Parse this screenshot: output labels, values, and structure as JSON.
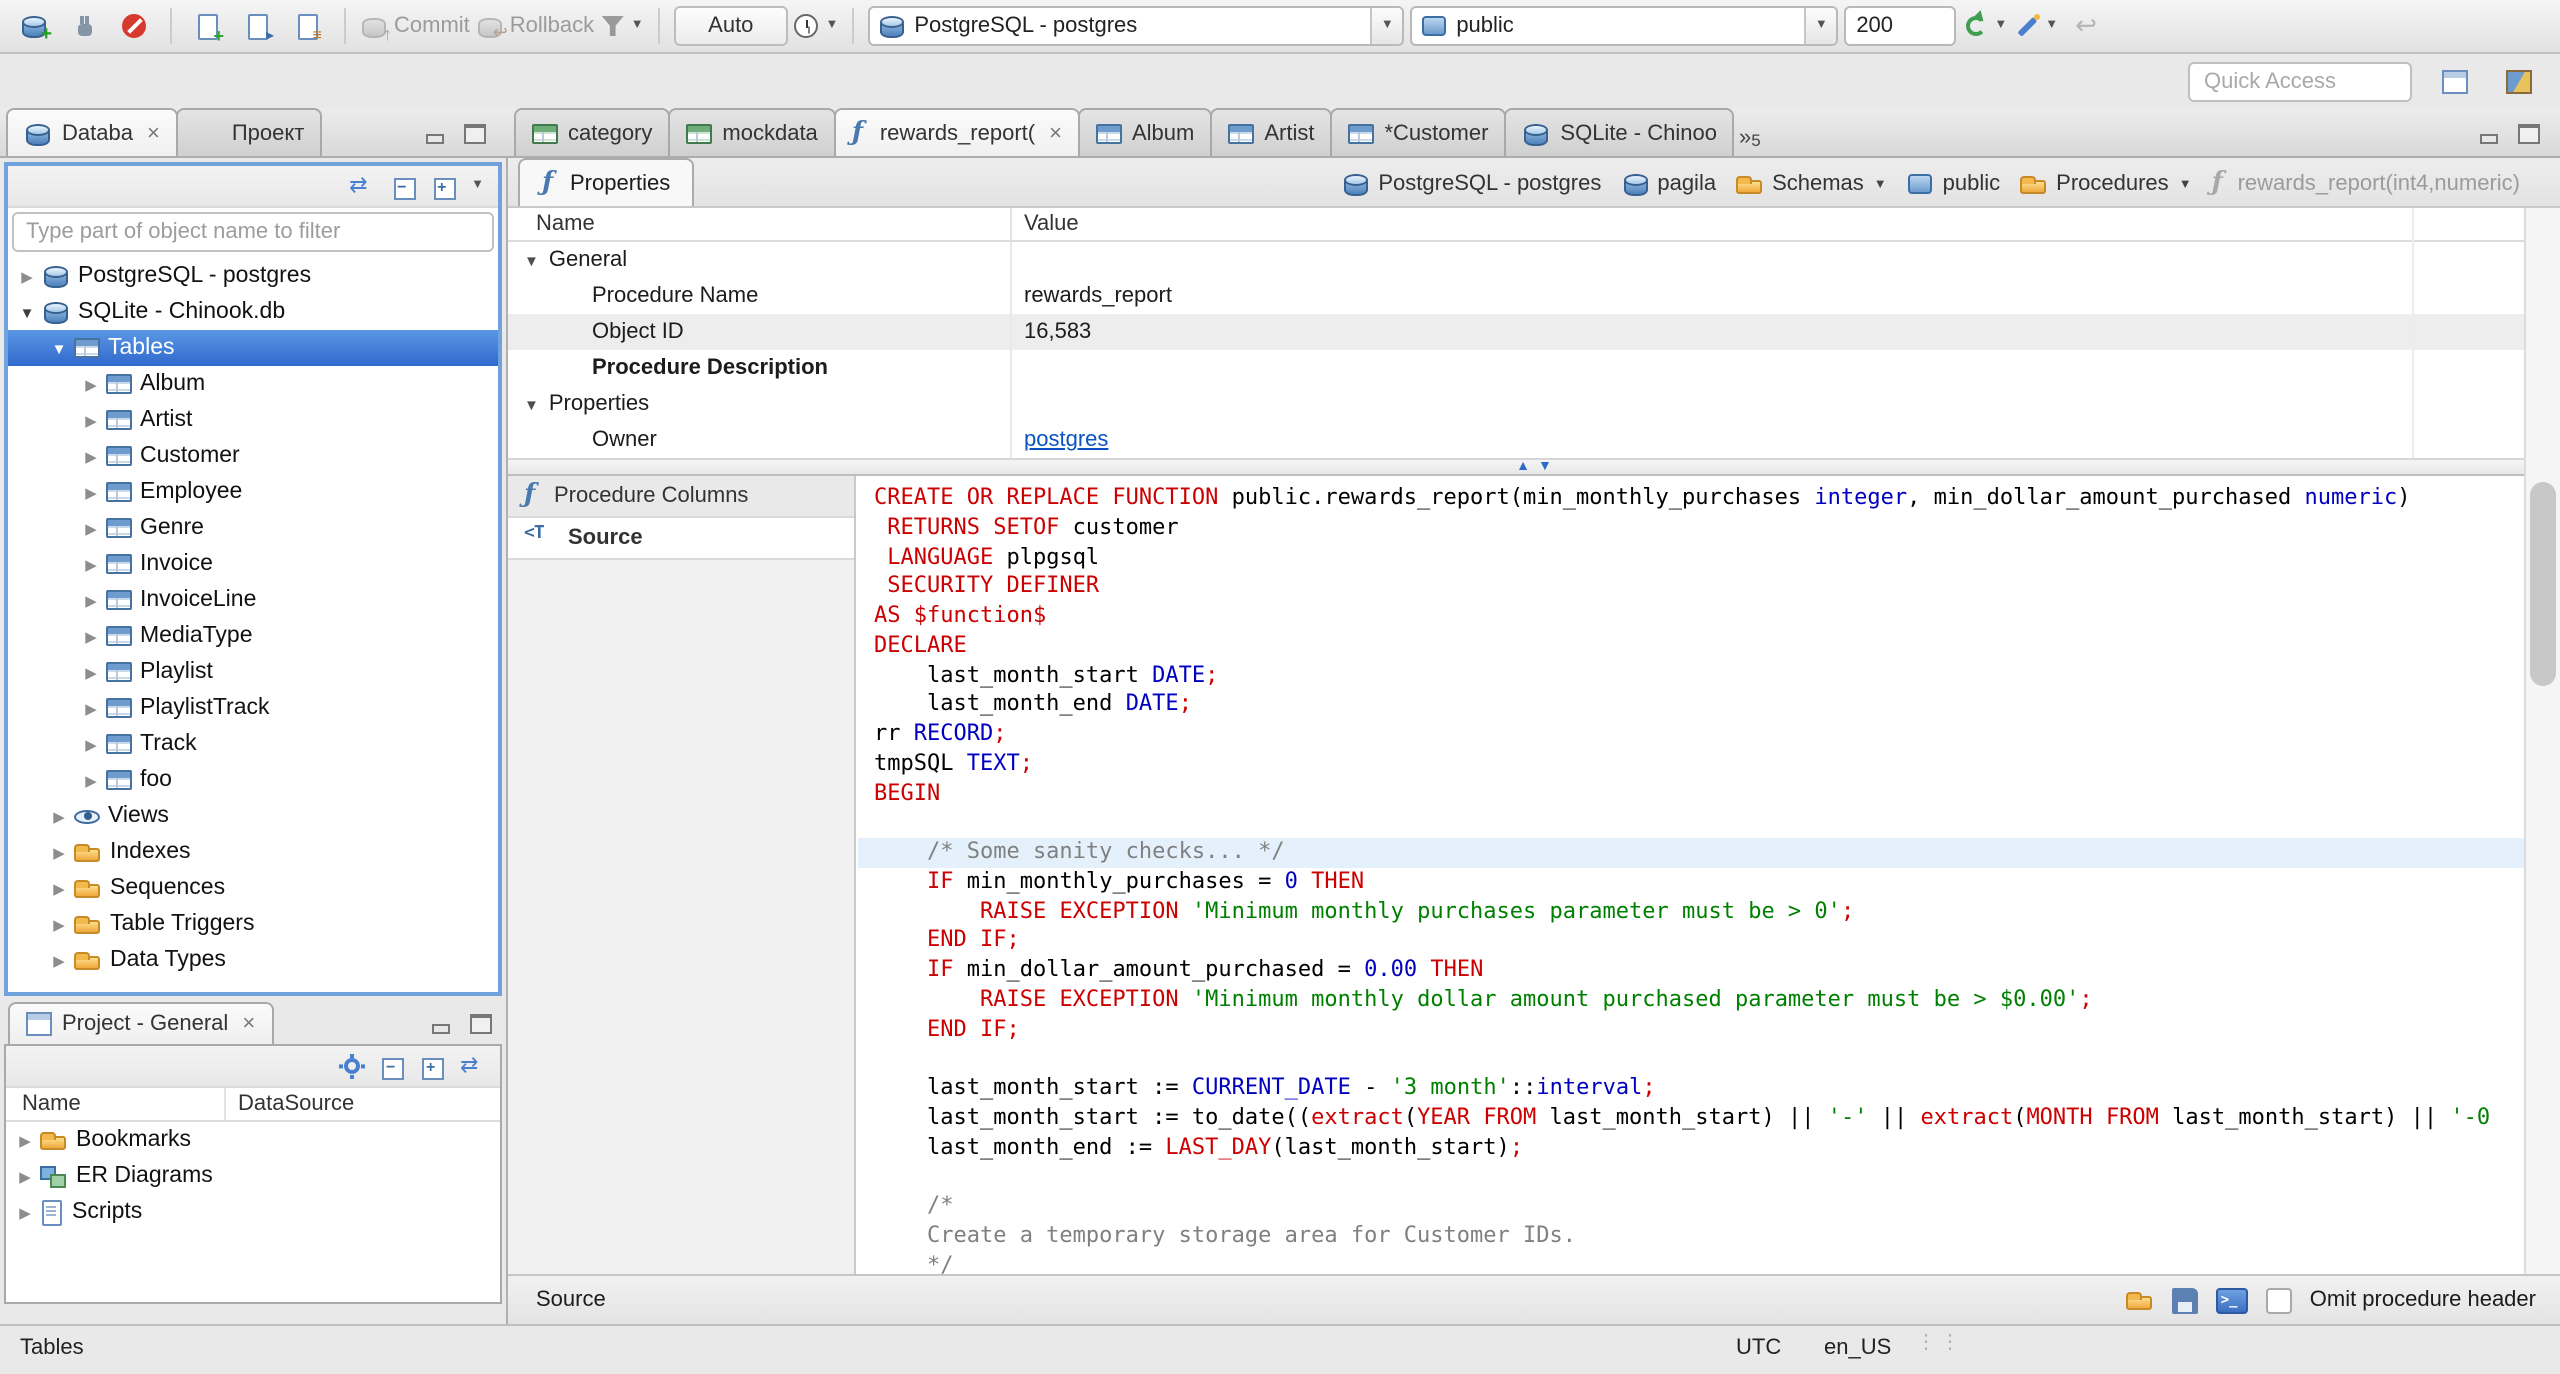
{
  "topbar": {
    "commit_label": "Commit",
    "rollback_label": "Rollback",
    "auto_label": "Auto",
    "connection_value": "PostgreSQL - postgres",
    "schema_value": "public",
    "fetch_size_value": "200"
  },
  "quick_access": {
    "placeholder": "Quick Access"
  },
  "left_tabs": [
    {
      "label": "Databa",
      "icon": "db-navigator",
      "active": true,
      "closable": true
    },
    {
      "label": "Проект",
      "icon": "project",
      "active": false,
      "closable": false
    }
  ],
  "editor_tabs": [
    {
      "label": "category",
      "icon": "data-grid",
      "active": false,
      "closable": false
    },
    {
      "label": "mockdata",
      "icon": "data-grid",
      "active": false,
      "closable": false
    },
    {
      "label": "rewards_report(",
      "icon": "function",
      "active": true,
      "closable": true
    },
    {
      "label": "Album",
      "icon": "table",
      "active": false,
      "closable": false
    },
    {
      "label": "Artist",
      "icon": "table",
      "active": false,
      "closable": false
    },
    {
      "label": "*Customer",
      "icon": "table",
      "active": false,
      "closable": false
    },
    {
      "label": "SQLite - Chinoo",
      "icon": "db-green",
      "active": false,
      "closable": false
    }
  ],
  "tab_overflow_count": "5",
  "navigator": {
    "filter_placeholder": "Type part of object name to filter",
    "tree": [
      {
        "label": "PostgreSQL - postgres",
        "level": 0,
        "icon": "db-postgres",
        "arrow": "collapsed"
      },
      {
        "label": "SQLite - Chinook.db",
        "level": 0,
        "icon": "db-sqlite",
        "arrow": "expanded"
      },
      {
        "label": "Tables",
        "level": 1,
        "icon": "table",
        "arrow": "expanded",
        "selected": true
      },
      {
        "label": "Album",
        "level": 2,
        "icon": "table",
        "arrow": "collapsed"
      },
      {
        "label": "Artist",
        "level": 2,
        "icon": "table",
        "arrow": "collapsed"
      },
      {
        "label": "Customer",
        "level": 2,
        "icon": "table",
        "arrow": "collapsed"
      },
      {
        "label": "Employee",
        "level": 2,
        "icon": "table",
        "arrow": "collapsed"
      },
      {
        "label": "Genre",
        "level": 2,
        "icon": "table",
        "arrow": "collapsed"
      },
      {
        "label": "Invoice",
        "level": 2,
        "icon": "table",
        "arrow": "collapsed"
      },
      {
        "label": "InvoiceLine",
        "level": 2,
        "icon": "table",
        "arrow": "collapsed"
      },
      {
        "label": "MediaType",
        "level": 2,
        "icon": "table",
        "arrow": "collapsed"
      },
      {
        "label": "Playlist",
        "level": 2,
        "icon": "table",
        "arrow": "collapsed"
      },
      {
        "label": "PlaylistTrack",
        "level": 2,
        "icon": "table",
        "arrow": "collapsed"
      },
      {
        "label": "Track",
        "level": 2,
        "icon": "table",
        "arrow": "collapsed"
      },
      {
        "label": "foo",
        "level": 2,
        "icon": "table",
        "arrow": "collapsed"
      },
      {
        "label": "Views",
        "level": 1,
        "icon": "eye",
        "arrow": "collapsed"
      },
      {
        "label": "Indexes",
        "level": 1,
        "icon": "folder",
        "arrow": "collapsed"
      },
      {
        "label": "Sequences",
        "level": 1,
        "icon": "folder",
        "arrow": "collapsed"
      },
      {
        "label": "Table Triggers",
        "level": 1,
        "icon": "folder",
        "arrow": "collapsed"
      },
      {
        "label": "Data Types",
        "level": 1,
        "icon": "folder",
        "arrow": "collapsed"
      }
    ]
  },
  "project_panel": {
    "title": "Project - General",
    "columns": {
      "name": "Name",
      "datasource": "DataSource"
    },
    "items": [
      {
        "label": "Bookmarks",
        "icon": "folder-bookmarks"
      },
      {
        "label": "ER Diagrams",
        "icon": "er-diagrams"
      },
      {
        "label": "Scripts",
        "icon": "scripts"
      }
    ]
  },
  "properties_editor": {
    "tab_label": "Properties",
    "breadcrumb": [
      {
        "label": "PostgreSQL - postgres",
        "icon": "db-postgres",
        "dropdown": false,
        "muted": false
      },
      {
        "label": "pagila",
        "icon": "db-blue",
        "dropdown": false,
        "muted": false
      },
      {
        "label": "Schemas",
        "icon": "folder-schemas",
        "dropdown": true,
        "muted": false
      },
      {
        "label": "public",
        "icon": "schema",
        "dropdown": false,
        "muted": false
      },
      {
        "label": "Procedures",
        "icon": "folder-procedures",
        "dropdown": true,
        "muted": false
      },
      {
        "label": "rewards_report(int4,numeric)",
        "icon": "function",
        "dropdown": false,
        "muted": true
      }
    ],
    "grid": {
      "name_header": "Name",
      "value_header": "Value",
      "rows": [
        {
          "kind": "group",
          "name": "General",
          "value": ""
        },
        {
          "kind": "prop",
          "name": "Procedure Name",
          "value": "rewards_report"
        },
        {
          "kind": "prop",
          "name": "Object ID",
          "value": "16,583",
          "shaded": true
        },
        {
          "kind": "prop",
          "name": "Procedure Description",
          "value": "",
          "bold": true
        },
        {
          "kind": "group",
          "name": "Properties",
          "value": ""
        },
        {
          "kind": "prop",
          "name": "Owner",
          "value": "postgres",
          "link": true
        }
      ]
    },
    "subtabs": [
      {
        "label": "Procedure Columns",
        "icon": "function",
        "active": false
      },
      {
        "label": "Source",
        "icon": "source",
        "active": true
      }
    ],
    "bottom": {
      "label": "Source",
      "omit_checkbox_label": "Omit procedure header"
    }
  },
  "source_editor": {
    "highlight_line": 12,
    "lines": [
      [
        [
          "k",
          "CREATE OR REPLACE FUNCTION"
        ],
        [
          "p",
          " public.rewards_report(min_monthly_purchases "
        ],
        [
          "t",
          "integer"
        ],
        [
          "p",
          ", min_dollar_amount_purchased "
        ],
        [
          "t",
          "numeric"
        ],
        [
          "p",
          ")"
        ]
      ],
      [
        [
          "k",
          " RETURNS SETOF"
        ],
        [
          "p",
          " customer"
        ]
      ],
      [
        [
          "k",
          " LANGUAGE"
        ],
        [
          "p",
          " plpgsql"
        ]
      ],
      [
        [
          "k",
          " SECURITY DEFINER"
        ]
      ],
      [
        [
          "k",
          "AS $function$"
        ]
      ],
      [
        [
          "k",
          "DECLARE"
        ]
      ],
      [
        [
          "p",
          "    last_month_start "
        ],
        [
          "t",
          "DATE"
        ],
        [
          "k",
          ";"
        ]
      ],
      [
        [
          "p",
          "    last_month_end "
        ],
        [
          "t",
          "DATE"
        ],
        [
          "k",
          ";"
        ]
      ],
      [
        [
          "p",
          "rr "
        ],
        [
          "t",
          "RECORD"
        ],
        [
          "k",
          ";"
        ]
      ],
      [
        [
          "p",
          "tmpSQL "
        ],
        [
          "t",
          "TEXT"
        ],
        [
          "k",
          ";"
        ]
      ],
      [
        [
          "k",
          "BEGIN"
        ]
      ],
      [
        [
          "p",
          ""
        ]
      ],
      [
        [
          "c",
          "    /* Some sanity checks... */"
        ]
      ],
      [
        [
          "p",
          "    "
        ],
        [
          "k",
          "IF"
        ],
        [
          "p",
          " min_monthly_purchases = "
        ],
        [
          "n",
          "0"
        ],
        [
          "p",
          " "
        ],
        [
          "k",
          "THEN"
        ]
      ],
      [
        [
          "p",
          "        "
        ],
        [
          "k",
          "RAISE EXCEPTION"
        ],
        [
          "p",
          " "
        ],
        [
          "s",
          "'Minimum monthly purchases parameter must be > 0'"
        ],
        [
          "k",
          ";"
        ]
      ],
      [
        [
          "p",
          "    "
        ],
        [
          "k",
          "END IF;"
        ]
      ],
      [
        [
          "p",
          "    "
        ],
        [
          "k",
          "IF"
        ],
        [
          "p",
          " min_dollar_amount_purchased = "
        ],
        [
          "n",
          "0.00"
        ],
        [
          "p",
          " "
        ],
        [
          "k",
          "THEN"
        ]
      ],
      [
        [
          "p",
          "        "
        ],
        [
          "k",
          "RAISE EXCEPTION"
        ],
        [
          "p",
          " "
        ],
        [
          "s",
          "'Minimum monthly dollar amount purchased parameter must be > $0.00'"
        ],
        [
          "k",
          ";"
        ]
      ],
      [
        [
          "p",
          "    "
        ],
        [
          "k",
          "END IF;"
        ]
      ],
      [
        [
          "p",
          ""
        ]
      ],
      [
        [
          "p",
          "    last_month_start := "
        ],
        [
          "t",
          "CURRENT_DATE"
        ],
        [
          "p",
          " - "
        ],
        [
          "s",
          "'3 month'"
        ],
        [
          "p",
          "::"
        ],
        [
          "t",
          "interval"
        ],
        [
          "k",
          ";"
        ]
      ],
      [
        [
          "p",
          "    last_month_start := to_date(("
        ],
        [
          "k",
          "extract"
        ],
        [
          "p",
          "("
        ],
        [
          "k",
          "YEAR"
        ],
        [
          "p",
          " "
        ],
        [
          "k",
          "FROM"
        ],
        [
          "p",
          " last_month_start) || "
        ],
        [
          "s",
          "'-'"
        ],
        [
          "p",
          " || "
        ],
        [
          "k",
          "extract"
        ],
        [
          "p",
          "("
        ],
        [
          "k",
          "MONTH"
        ],
        [
          "p",
          " "
        ],
        [
          "k",
          "FROM"
        ],
        [
          "p",
          " last_month_start) || "
        ],
        [
          "s",
          "'-0"
        ]
      ],
      [
        [
          "p",
          "    last_month_end := "
        ],
        [
          "k",
          "LAST_DAY"
        ],
        [
          "p",
          "(last_month_start)"
        ],
        [
          "k",
          ";"
        ]
      ],
      [
        [
          "p",
          ""
        ]
      ],
      [
        [
          "c",
          "    /*"
        ]
      ],
      [
        [
          "c",
          "    Create a temporary storage area for Customer IDs."
        ]
      ],
      [
        [
          "c",
          "    */"
        ]
      ]
    ]
  },
  "status_bar": {
    "left": "Tables",
    "timezone": "UTC",
    "locale": "en_US"
  },
  "colors": {
    "keyword": "#cc0000",
    "datatype": "#0000c0",
    "number": "#0000c0",
    "string": "#008000",
    "comment": "#808080",
    "selection_bg": "#3069cd",
    "link": "#0a53c4",
    "current_line_bg": "#e4f1fc"
  }
}
